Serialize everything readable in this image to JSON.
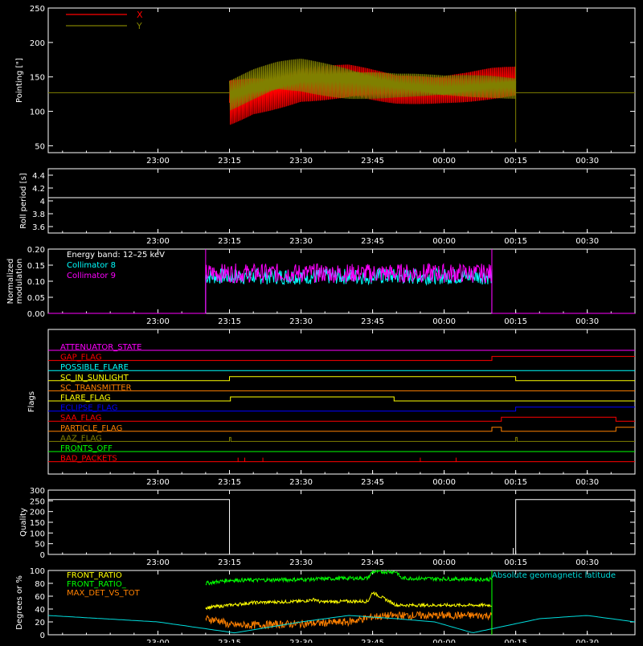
{
  "chart_data": [
    {
      "type": "line",
      "ylabel": "Pointing [\"]",
      "ylim": [
        40,
        250
      ],
      "xlim": [
        -23,
        100
      ],
      "yticks": [
        50,
        100,
        150,
        200,
        250
      ],
      "xtick_labels": [
        "23:00",
        "23:15",
        "23:30",
        "23:45",
        "00:00",
        "00:15",
        "00:30"
      ],
      "legend": [
        "X",
        "Y"
      ],
      "legend_placement": "top-left",
      "x_window": [
        15,
        75
      ],
      "baseline": 127,
      "series": [
        {
          "name": "X",
          "color": "#ff0000",
          "envelope_x": [
            15,
            20,
            30,
            40,
            50,
            60,
            65,
            70,
            75
          ],
          "envelope_upper": [
            150,
            158,
            168,
            168,
            155,
            162,
            162,
            165,
            165
          ],
          "envelope_lower": [
            75,
            95,
            112,
            108,
            108,
            112,
            112,
            112,
            112
          ]
        },
        {
          "name": "Y",
          "color": "#808000",
          "envelope_x": [
            15,
            20,
            25,
            30,
            40,
            50,
            60,
            70,
            75
          ],
          "envelope_upper": [
            148,
            162,
            172,
            178,
            172,
            158,
            152,
            155,
            155
          ],
          "envelope_lower": [
            98,
            110,
            120,
            122,
            118,
            118,
            115,
            118,
            118
          ]
        }
      ]
    },
    {
      "type": "line",
      "ylabel": "Roll period [s]",
      "ylim": [
        3.5,
        4.5
      ],
      "yticks": [
        3.6,
        3.8,
        4.0,
        4.2,
        4.4
      ],
      "xtick_labels": [
        "23:00",
        "23:15",
        "23:30",
        "23:45",
        "00:00",
        "00:15",
        "00:30"
      ],
      "series": [
        {
          "name": "",
          "color": "#ffffff",
          "value": 4.05
        }
      ]
    },
    {
      "type": "line",
      "ylabel": "Normalized modulation",
      "ylim": [
        0,
        0.2
      ],
      "yticks": [
        0.0,
        0.05,
        0.1,
        0.15,
        0.2
      ],
      "xtick_labels": [
        "23:00",
        "23:15",
        "23:30",
        "23:45",
        "00:00",
        "00:15",
        "00:30"
      ],
      "annotation": "Energy band: 12–25 keV",
      "x_window": [
        10,
        70
      ],
      "series": [
        {
          "name": "Collimator 8",
          "color": "#00ffff",
          "mean": 0.115,
          "spread": 0.025
        },
        {
          "name": "Collimator 9",
          "color": "#ff00ff",
          "mean": 0.125,
          "spread": 0.03
        }
      ]
    },
    {
      "type": "line",
      "ylabel": "Flags",
      "xtick_labels": [
        "23:00",
        "23:15",
        "23:30",
        "23:45",
        "00:00",
        "00:15",
        "00:30"
      ],
      "flags": [
        {
          "name": "ATTENUATOR_STATE",
          "color": "#ff00ff",
          "steps": []
        },
        {
          "name": "GAP_FLAG",
          "color": "#ff0000",
          "steps": [
            [
              70,
              1
            ]
          ]
        },
        {
          "name": "POSSIBLE_FLARE",
          "color": "#00ffff",
          "steps": []
        },
        {
          "name": "SC_IN_SUNLIGHT",
          "color": "#ffff00",
          "steps": [
            [
              15,
              1
            ],
            [
              75,
              0
            ]
          ]
        },
        {
          "name": "SC_TRANSMITTER",
          "color": "#ff8000",
          "steps": []
        },
        {
          "name": "FLARE_FLAG",
          "color": "#ffff00",
          "steps": [
            [
              15.2,
              1
            ],
            [
              49.5,
              0
            ]
          ]
        },
        {
          "name": "ECLIPSE_FLAG",
          "color": "#0000ff",
          "steps": [
            [
              15,
              0
            ],
            [
              75,
              1
            ]
          ]
        },
        {
          "name": "SAA_FLAG",
          "color": "#ff0000",
          "steps": [
            [
              72,
              1
            ],
            [
              96,
              0
            ]
          ]
        },
        {
          "name": "PARTICLE_FLAG",
          "color": "#ff8000",
          "steps": [
            [
              70,
              1
            ],
            [
              72,
              0
            ],
            [
              96,
              1
            ]
          ]
        },
        {
          "name": "AAZ_FLAG",
          "color": "#808000",
          "steps": [
            [
              15,
              1
            ],
            [
              15.3,
              0
            ],
            [
              75,
              1
            ],
            [
              75.3,
              0
            ]
          ]
        },
        {
          "name": "FRONTS_OFF",
          "color": "#00ff00",
          "steps": []
        },
        {
          "name": "BAD_PACKETS",
          "color": "#ff0000",
          "steps": [],
          "spikes": [
            16.8,
            18.2,
            22,
            55,
            62.5
          ]
        }
      ]
    },
    {
      "type": "line",
      "ylabel": "Quality",
      "ylim": [
        0,
        300
      ],
      "yticks": [
        0,
        50,
        100,
        150,
        200,
        250,
        300
      ],
      "xtick_labels": [
        "23:00",
        "23:15",
        "23:30",
        "23:45",
        "00:00",
        "00:15",
        "00:30"
      ],
      "series": [
        {
          "name": "",
          "color": "#ffffff",
          "value_outside": 256,
          "value_inside": 0,
          "window": [
            15,
            75
          ]
        }
      ]
    },
    {
      "type": "line",
      "ylabel": "Degrees or %",
      "ylim": [
        0,
        100
      ],
      "yticks": [
        0,
        20,
        40,
        60,
        80,
        100
      ],
      "xtick_labels": [
        "23:00",
        "23:15",
        "23:30",
        "23:45",
        "00:00",
        "00:15",
        "00:30"
      ],
      "annotation": "Absolute geomagnetic latitude",
      "legend": [
        "FRONT_RATIO",
        "FRONT_RATIO_",
        "MAX_DET_VS_TOT"
      ],
      "x_window": [
        10,
        70
      ],
      "series": [
        {
          "name": "FRONT_RATIO",
          "color": "#ffff00",
          "x": [
            10,
            15,
            20,
            30,
            33,
            34,
            40,
            44,
            45,
            50,
            60,
            70
          ],
          "y": [
            42,
            46,
            50,
            52,
            55,
            51,
            52,
            52,
            66,
            46,
            46,
            46
          ]
        },
        {
          "name": "FRONT_RATIO_",
          "color": "#00ff00",
          "x": [
            10,
            15,
            20,
            30,
            40,
            44,
            45,
            50,
            51,
            60,
            70
          ],
          "y": [
            80,
            85,
            85,
            86,
            88,
            88,
            98,
            98,
            88,
            87,
            86
          ]
        },
        {
          "name": "MAX_DET_VS_TOT",
          "color": "#ff8000",
          "x": [
            10,
            13,
            15,
            20,
            30,
            40,
            45,
            50,
            60,
            70
          ],
          "y": [
            25,
            22,
            15,
            15,
            17,
            20,
            28,
            30,
            30,
            30
          ]
        },
        {
          "name": "Absolute geomagnetic latitude",
          "color": "#00dddd",
          "x": [
            -23,
            0,
            16,
            30,
            40,
            50,
            58,
            66,
            80,
            90,
            100
          ],
          "y": [
            30,
            20,
            3,
            20,
            30,
            25,
            20,
            3,
            25,
            30,
            20
          ]
        }
      ]
    }
  ]
}
